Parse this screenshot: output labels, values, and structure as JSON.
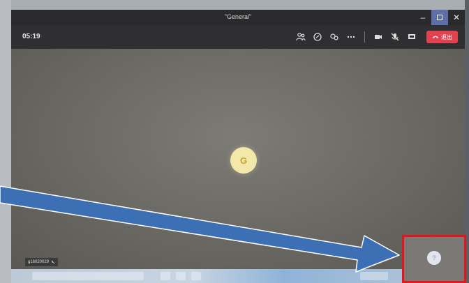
{
  "window": {
    "title": "\"General\""
  },
  "toolbar": {
    "timer": "05:19",
    "icons": [
      "participants-icon",
      "chat-icon",
      "reactions-icon",
      "more-icon",
      "camera-off-icon",
      "mic-off-icon",
      "share-icon"
    ],
    "hangup_label": "退出"
  },
  "stage": {
    "avatar_initial": "G",
    "name_tag": "g16020029"
  },
  "preview": {
    "avatar_initial": "?"
  },
  "colors": {
    "hangup": "#e0434f",
    "highlight": "#e8141c",
    "arrow": "#3d6fb4",
    "avatar_bg": "#f2e8a8"
  }
}
